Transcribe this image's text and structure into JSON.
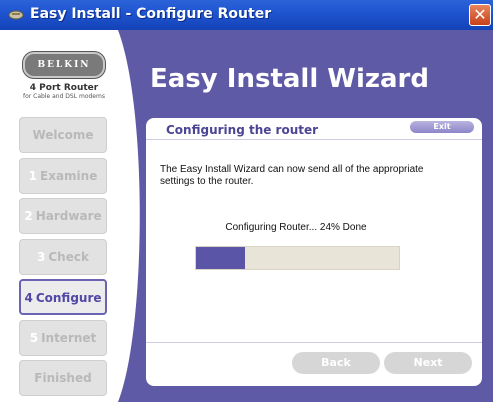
{
  "window": {
    "title": "Easy Install - Configure Router",
    "close_label": "✕"
  },
  "brand": {
    "logo_text": "BELKIN",
    "product": "4 Port Router",
    "product_sub": "for Cable and DSL modems"
  },
  "steps": [
    {
      "num": "",
      "label": "Welcome",
      "state": "disabled"
    },
    {
      "num": "1",
      "label": "Examine",
      "state": "disabled"
    },
    {
      "num": "2",
      "label": "Hardware",
      "state": "disabled"
    },
    {
      "num": "3",
      "label": "Check",
      "state": "disabled"
    },
    {
      "num": "4",
      "label": "Configure",
      "state": "active"
    },
    {
      "num": "5",
      "label": "Internet",
      "state": "disabled"
    },
    {
      "num": "",
      "label": "Finished",
      "state": "disabled"
    }
  ],
  "header": {
    "title": "Easy Install Wizard"
  },
  "card": {
    "title": "Configuring the router",
    "exit_label": "Exit",
    "description": "The Easy Install Wizard can now send all of the appropriate settings to the router.",
    "status": "Configuring Router... 24% Done",
    "progress_percent": 24
  },
  "buttons": {
    "back": "Back",
    "next": "Next"
  },
  "colors": {
    "accent": "#5f5aa6",
    "progress_fill": "#5a55a6",
    "titlebar": "#1f55d0"
  }
}
